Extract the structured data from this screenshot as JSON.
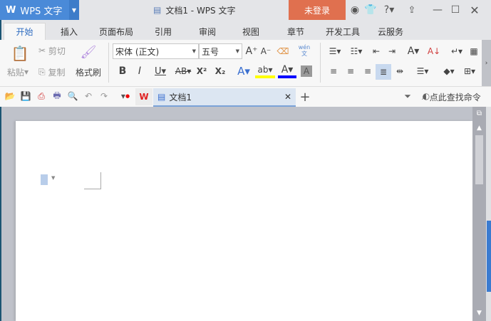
{
  "app": {
    "name": "WPS 文字",
    "window_title": "文档1 - WPS 文字",
    "login_button": "未登录"
  },
  "tabs": [
    {
      "label": "开始",
      "active": true
    },
    {
      "label": "插入"
    },
    {
      "label": "页面布局"
    },
    {
      "label": "引用"
    },
    {
      "label": "审阅"
    },
    {
      "label": "视图"
    },
    {
      "label": "章节"
    },
    {
      "label": "开发工具"
    },
    {
      "label": "云服务"
    }
  ],
  "ribbon": {
    "paste": "粘贴",
    "cut": "剪切",
    "copy": "复制",
    "format_painter": "格式刷",
    "font_name": "宋体 (正文)",
    "font_size": "五号",
    "pinyin_top": "wén",
    "pinyin_bottom": "文"
  },
  "document_tab": {
    "label": "文档1"
  },
  "search": {
    "label": "点此查找命令"
  },
  "colors": {
    "accent": "#4a8ad8",
    "login": "#e0704f",
    "highlight": "#ffff00",
    "font_color": "#0000ff"
  }
}
